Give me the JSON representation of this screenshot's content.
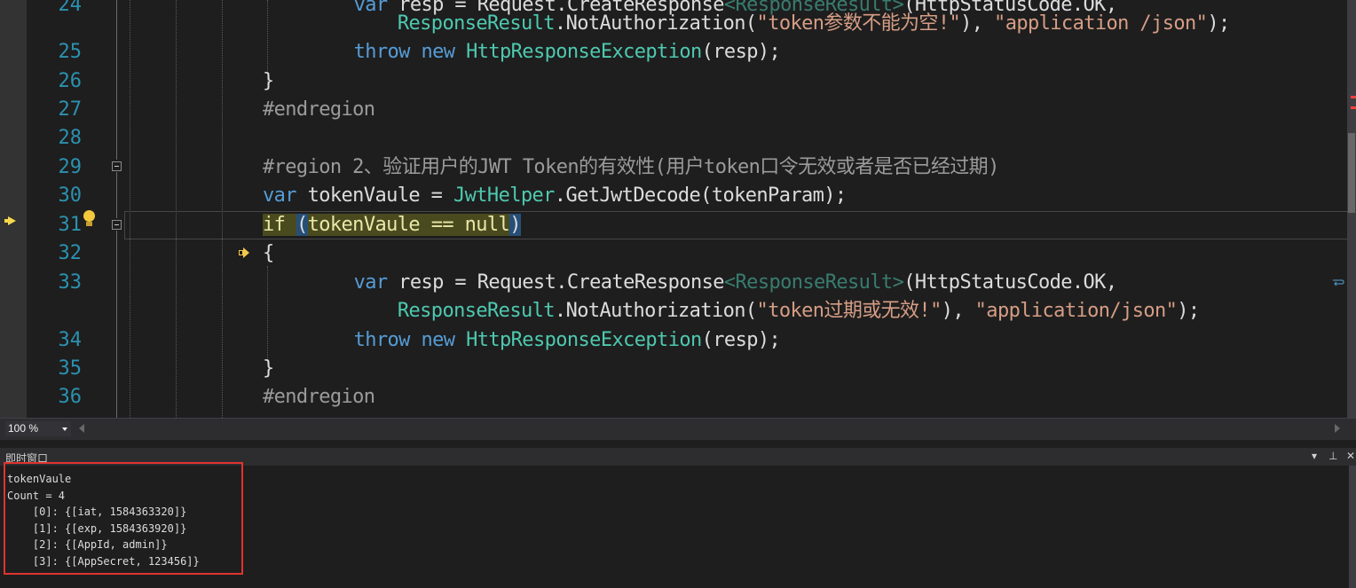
{
  "editor": {
    "lines": [
      {
        "no": "24",
        "segments": [
          [
            "",
            "    "
          ],
          [
            "kw",
            "var"
          ],
          [
            "",
            " resp = Request.CreateResponse"
          ],
          [
            "tyd",
            "<ResponseResult>"
          ],
          [
            "",
            "(HttpStatusCode.OK,"
          ]
        ]
      },
      {
        "no": "",
        "segments": [
          [
            "",
            "      "
          ],
          [
            "ty",
            "ResponseResult"
          ],
          [
            "",
            ".NotAuthorization("
          ],
          [
            "str",
            "\"token参数不能为空!\""
          ],
          [
            "",
            "), "
          ],
          [
            "str",
            "\"application /json\""
          ],
          [
            "",
            ");"
          ]
        ]
      },
      {
        "no": "25",
        "segments": [
          [
            "",
            "    "
          ],
          [
            "kw",
            "throw"
          ],
          [
            "",
            " "
          ],
          [
            "kw",
            "new"
          ],
          [
            "",
            " "
          ],
          [
            "ty",
            "HttpResponseException"
          ],
          [
            "",
            "(resp);"
          ]
        ]
      },
      {
        "no": "26",
        "segments": [
          [
            "",
            "}"
          ]
        ]
      },
      {
        "no": "27",
        "segments": [
          [
            "pre",
            "#endregion"
          ]
        ]
      },
      {
        "no": "28",
        "segments": [
          [
            "",
            ""
          ]
        ]
      },
      {
        "no": "29",
        "segments": [
          [
            "pre",
            "#region 2、验证用户的JWT Token的有效性(用户token口令无效或者是否已经过期)"
          ]
        ]
      },
      {
        "no": "30",
        "segments": [
          [
            "kw",
            "var"
          ],
          [
            "",
            " tokenVaule = "
          ],
          [
            "ty",
            "JwtHelper"
          ],
          [
            "",
            ".GetJwtDecode(tokenParam);"
          ]
        ]
      },
      {
        "no": "31",
        "segments": [
          [
            "hl-yellow",
            "if "
          ],
          [
            "hl-blue",
            "("
          ],
          [
            "hl-yellow",
            "tokenVaule == null"
          ],
          [
            "hl-blue",
            ")"
          ]
        ]
      },
      {
        "no": "32",
        "segments": [
          [
            "",
            "{"
          ]
        ]
      },
      {
        "no": "33",
        "segments": [
          [
            "",
            "    "
          ],
          [
            "kw",
            "var"
          ],
          [
            "",
            " resp = Request.CreateResponse"
          ],
          [
            "tyd",
            "<ResponseResult>"
          ],
          [
            "",
            "(HttpStatusCode.OK,"
          ]
        ]
      },
      {
        "no": "",
        "segments": [
          [
            "",
            "      "
          ],
          [
            "ty",
            "ResponseResult"
          ],
          [
            "",
            ".NotAuthorization("
          ],
          [
            "str",
            "\"token过期或无效!\""
          ],
          [
            "",
            "), "
          ],
          [
            "str",
            "\"application/json\""
          ],
          [
            "",
            ");"
          ]
        ]
      },
      {
        "no": "34",
        "segments": [
          [
            "",
            "    "
          ],
          [
            "kw",
            "throw"
          ],
          [
            "",
            " "
          ],
          [
            "kw",
            "new"
          ],
          [
            "",
            " "
          ],
          [
            "ty",
            "HttpResponseException"
          ],
          [
            "",
            "(resp);"
          ]
        ]
      },
      {
        "no": "35",
        "segments": [
          [
            "",
            "}"
          ]
        ]
      },
      {
        "no": "36",
        "segments": [
          [
            "pre",
            "#endregion"
          ]
        ]
      }
    ]
  },
  "statusbar": {
    "zoom": "100 %"
  },
  "immediate": {
    "title": "即时窗口",
    "output": [
      "tokenVaule",
      "Count = 4",
      "    [0]: {[iat, 1584363320]}",
      "    [1]: {[exp, 1584363920]}",
      "    [2]: {[AppId, admin]}",
      "    [3]: {[AppSecret, 123456]}"
    ]
  }
}
